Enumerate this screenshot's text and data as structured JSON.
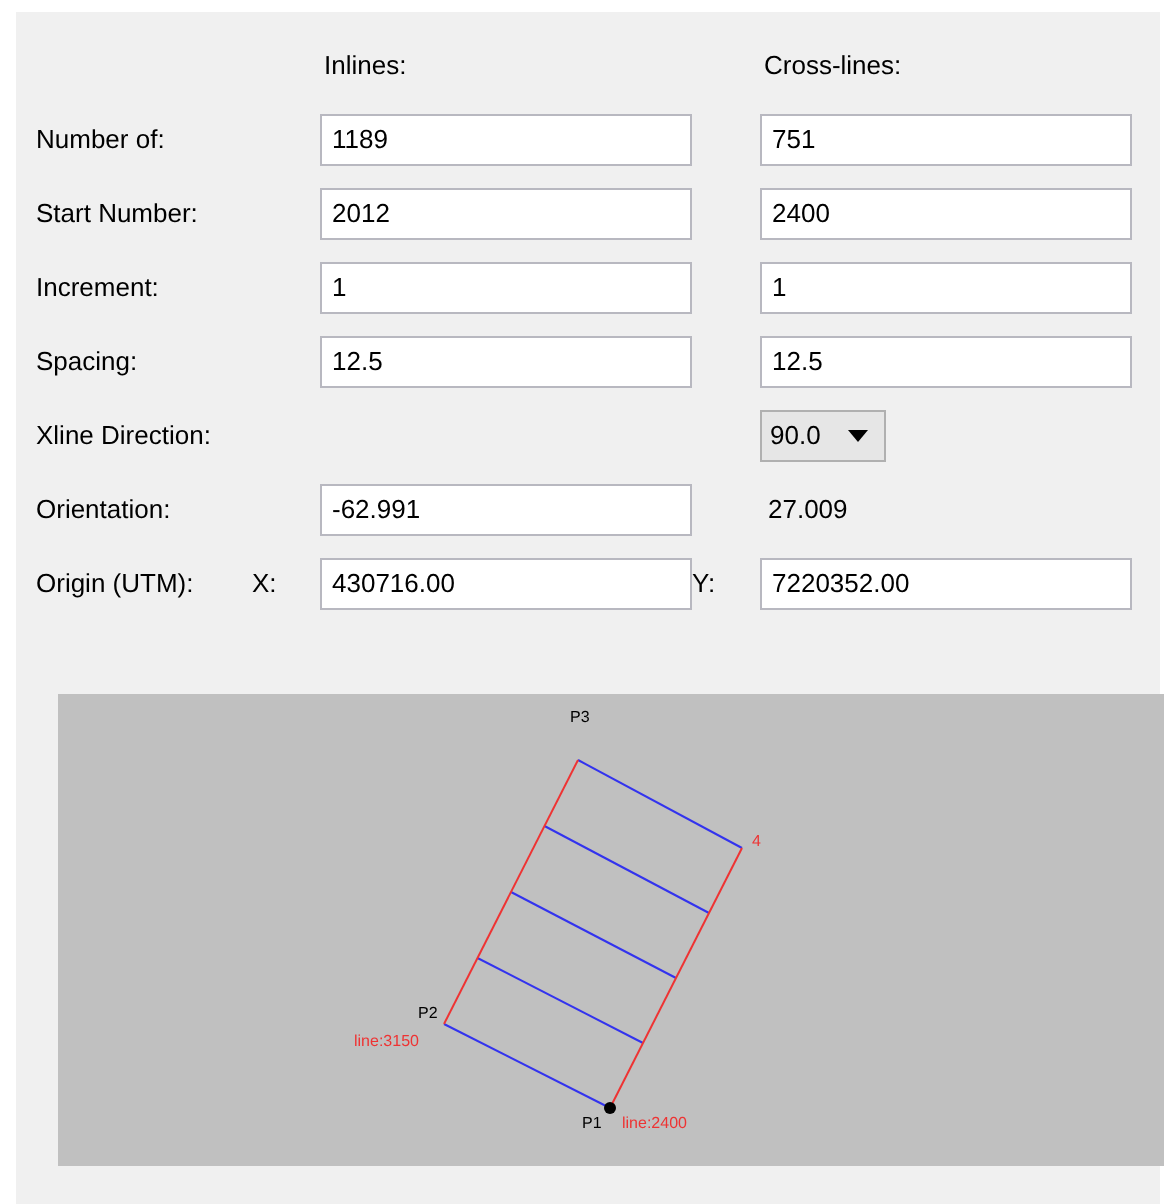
{
  "columns": [
    "Inlines:",
    "Cross-lines:"
  ],
  "rows": [
    {
      "kind": "fields",
      "label": "Number of:",
      "inline": "1189",
      "crossline": "751"
    },
    {
      "kind": "fields",
      "label": "Start Number:",
      "inline": "2012",
      "crossline": "2400"
    },
    {
      "kind": "fields",
      "label": "Increment:",
      "inline": "1",
      "crossline": "1"
    },
    {
      "kind": "fields",
      "label": "Spacing:",
      "inline": "12.5",
      "crossline": "12.5"
    },
    {
      "kind": "dropdown",
      "label": "Xline Direction:",
      "crossline": "90.0"
    },
    {
      "kind": "field_text",
      "label": "Orientation:",
      "inline": "-62.991",
      "crossline": "27.009"
    },
    {
      "kind": "coords",
      "label": "Origin (UTM):",
      "x_label": "X:",
      "inline": "430716.00",
      "y_label": "Y:",
      "crossline": "7220352.00"
    }
  ],
  "diagram": {
    "corner_labels": [
      "P3",
      "P2",
      "P1",
      "4"
    ],
    "line_labels": [
      "line:3150",
      "line:2400"
    ]
  }
}
